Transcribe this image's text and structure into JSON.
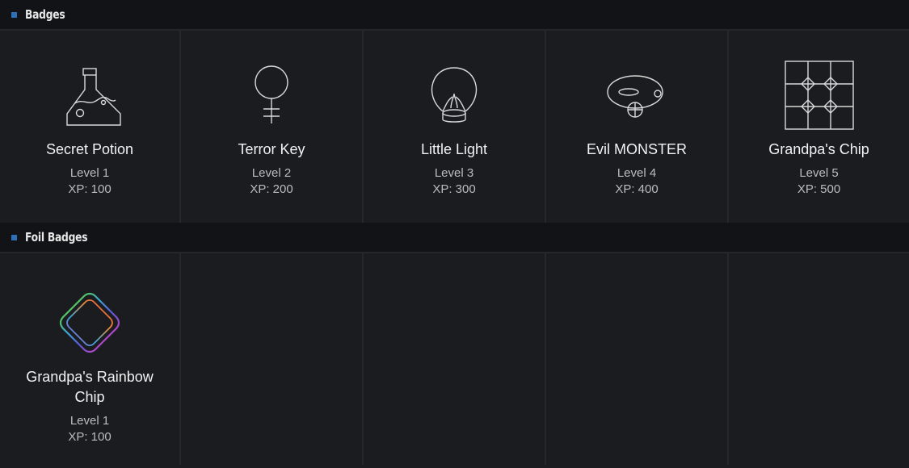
{
  "sections": {
    "badges": {
      "title": "Badges",
      "items": [
        {
          "name": "Secret Potion",
          "level": "Level 1",
          "xp": "XP: 100",
          "icon": "potion-flask-icon"
        },
        {
          "name": "Terror Key",
          "level": "Level 2",
          "xp": "XP: 200",
          "icon": "female-symbol-key-icon"
        },
        {
          "name": "Little Light",
          "level": "Level 3",
          "xp": "XP: 300",
          "icon": "lightbulb-icon"
        },
        {
          "name": "Evil MONSTER",
          "level": "Level 4",
          "xp": "XP: 400",
          "icon": "monster-face-icon"
        },
        {
          "name": "Grandpa's Chip",
          "level": "Level 5",
          "xp": "XP: 500",
          "icon": "chip-grid-icon"
        }
      ]
    },
    "foil_badges": {
      "title": "Foil Badges",
      "items": [
        {
          "name": "Grandpa's Rainbow Chip",
          "level": "Level 1",
          "xp": "XP: 100",
          "icon": "rainbow-diamond-icon"
        }
      ]
    }
  },
  "colors": {
    "background": "#1b1c20",
    "header_background": "#121316",
    "marker": "#2f6fb8",
    "title_text": "#f2f2f2",
    "sub_text": "#b9bcc2",
    "divider": "#25272c"
  }
}
